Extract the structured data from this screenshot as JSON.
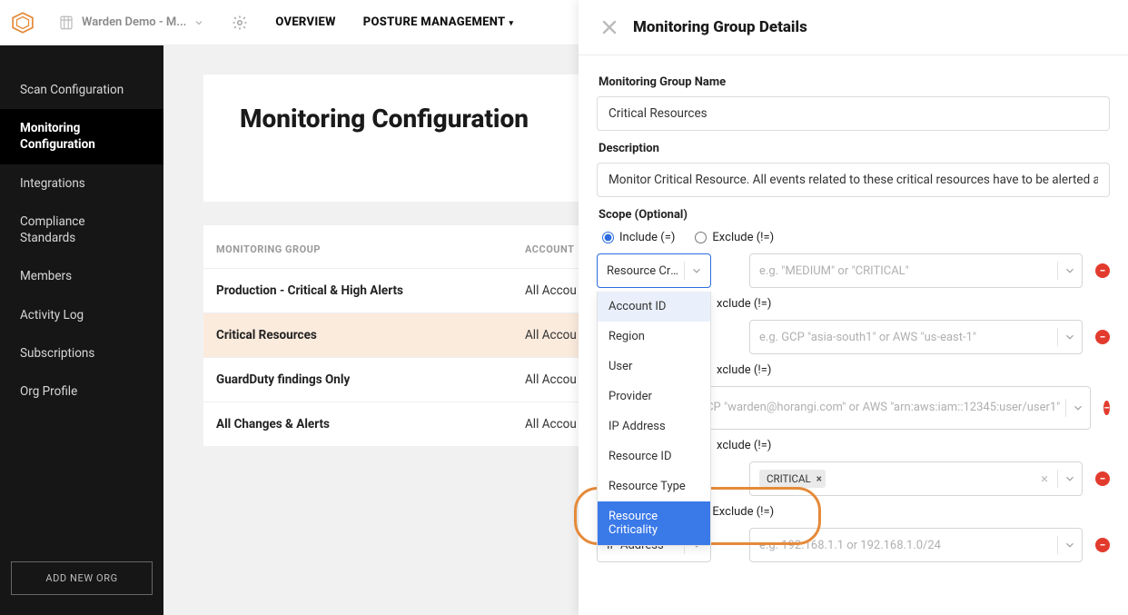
{
  "tenant": {
    "name": "Warden Demo - M..."
  },
  "topnav": {
    "overview": "OVERVIEW",
    "posture": "POSTURE MANAGEMENT"
  },
  "sidebar": {
    "items": [
      "Scan Configuration",
      "Monitoring Configuration",
      "Integrations",
      "Compliance Standards",
      "Members",
      "Activity Log",
      "Subscriptions",
      "Org Profile"
    ],
    "add_org": "ADD NEW ORG"
  },
  "page": {
    "title": "Monitoring Configuration",
    "col_group": "MONITORING GROUP",
    "col_account": "ACCOUNT",
    "rows": [
      {
        "name": "Production - Critical & High Alerts",
        "account": "All Accou"
      },
      {
        "name": "Critical Resources",
        "account": "All Accou"
      },
      {
        "name": "GuardDuty findings Only",
        "account": "All Accou"
      },
      {
        "name": "All Changes & Alerts",
        "account": "All Accou"
      }
    ]
  },
  "drawer": {
    "title": "Monitoring Group Details",
    "name_label": "Monitoring Group Name",
    "name_value": "Critical Resources",
    "desc_label": "Description",
    "desc_value": "Monitor Critical Resource. All events related to these critical resources have to be alerted and  inves",
    "scope_label": "Scope (Optional)",
    "include_label": "Include (=)",
    "exclude_label": "Exclude (!=)",
    "rows": [
      {
        "field": "Resource Cri...",
        "placeholder": "e.g. \"MEDIUM\" or \"CRITICAL\"",
        "include": true,
        "focused": true,
        "dropdown_open": true
      },
      {
        "field": "",
        "placeholder": "e.g. GCP \"asia-south1\" or AWS \"us-east-1\"",
        "include": true,
        "exclude_visible": "xclude (!=)"
      },
      {
        "field": "",
        "placeholder": "e.g. GCP \"warden@horangi.com\" or AWS \"arn:aws:iam::12345:user/user1\"",
        "include": true,
        "tall": true,
        "exclude_visible": "xclude (!=)"
      },
      {
        "field": "",
        "chip": "CRITICAL",
        "include": true,
        "exclude_visible": "xclude (!=)",
        "has_clear": true
      },
      {
        "field": "IP Address",
        "placeholder": "e.g. 192.168.1.1 or 192.168.1.0/24",
        "include": true
      }
    ],
    "dropdown_options": [
      "Account ID",
      "Region",
      "User",
      "Provider",
      "IP Address",
      "Resource ID",
      "Resource Type",
      "Resource Criticality"
    ]
  }
}
